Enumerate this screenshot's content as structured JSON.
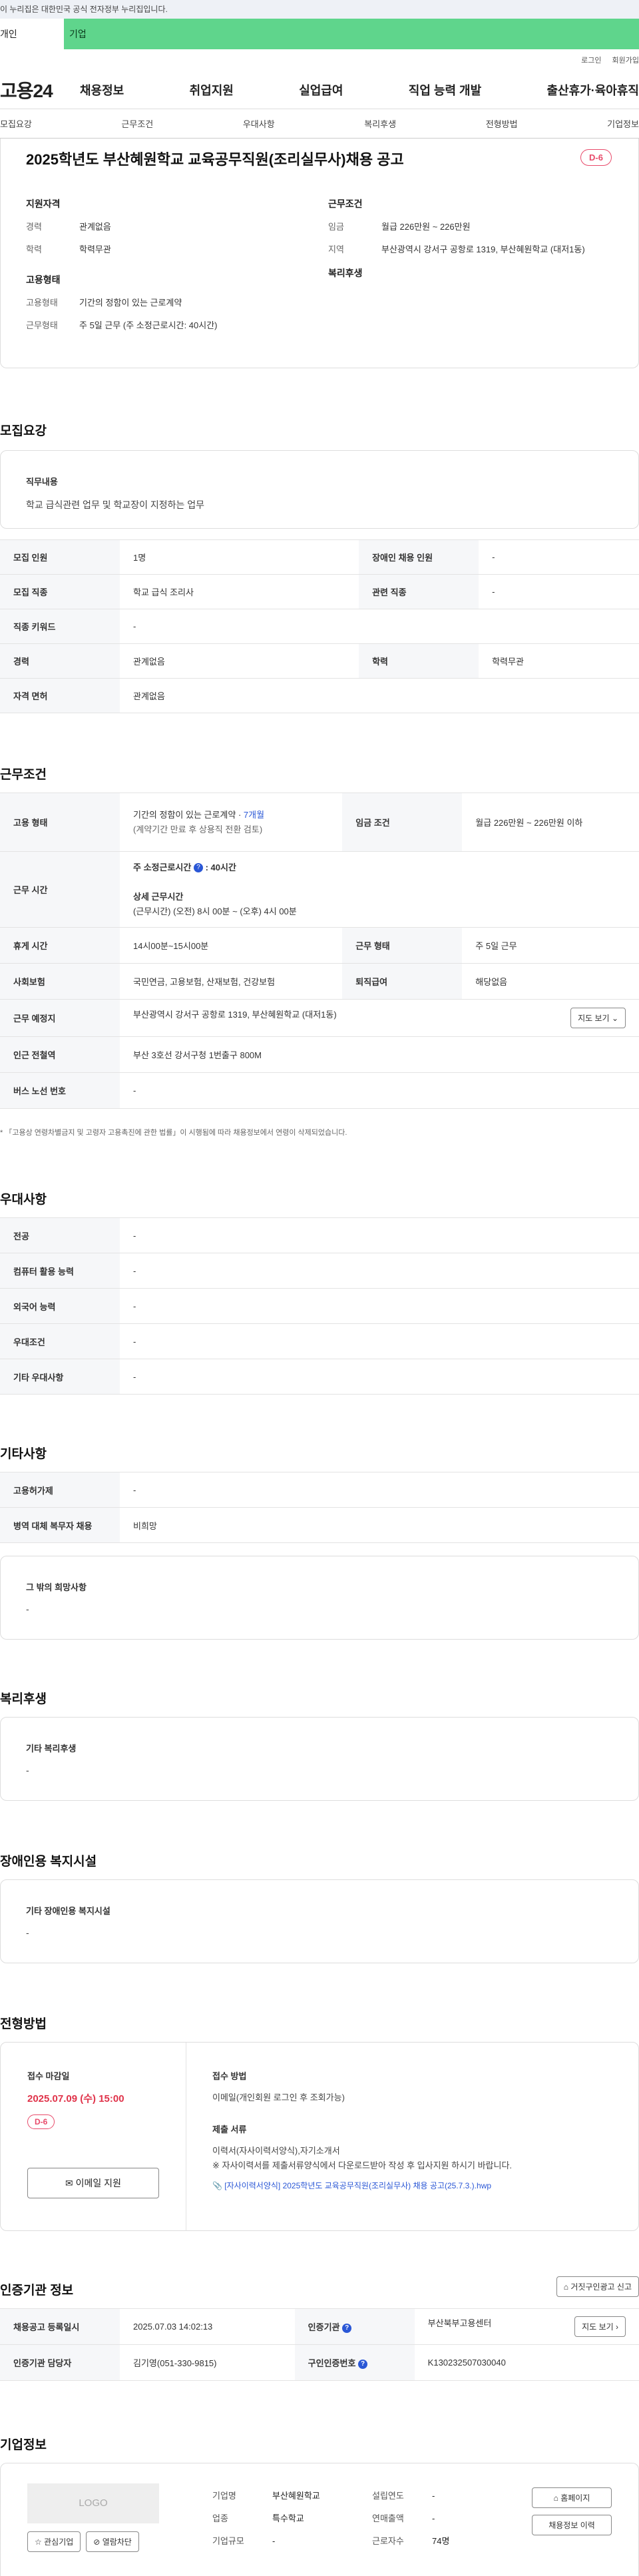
{
  "gov_banner": "이 누리집은 대한민국 공식 전자정부 누리집입니다.",
  "tabs": {
    "person": "개인",
    "company": "기업"
  },
  "util": {
    "login": "로그인",
    "join": "회원가입"
  },
  "logo": "고용24",
  "gnb": [
    "채용정보",
    "취업지원",
    "실업급여",
    "직업 능력 개발",
    "출산휴가·육아휴직"
  ],
  "subnav": [
    "모집요강",
    "근무조건",
    "우대사항",
    "복리후생",
    "전형방법",
    "기업정보"
  ],
  "job": {
    "title": "2025학년도 부산혜원학교 교육공무직원(조리실무사)채용 공고",
    "dday": "D-6",
    "summary": {
      "qualification_head": "지원자격",
      "career_key": "경력",
      "career_val": "관계없음",
      "edu_key": "학력",
      "edu_val": "학력무관",
      "employment_head": "고용형태",
      "emp_type_key": "고용형태",
      "emp_type_val": "기간의 정함이 있는 근로계약",
      "work_type_key": "근무형태",
      "work_type_val": "주 5일 근무 (주 소정근로시간: 40시간)",
      "condition_head": "근무조건",
      "wage_key": "임금",
      "wage_val": "월급 226만원 ~ 226만원",
      "location_key": "지역",
      "location_val": "부산광역시 강서구 공항로 1319, 부산혜원학교 (대저1동)",
      "welfare_head": "복리후생"
    }
  },
  "recruit": {
    "section": "모집요강",
    "duty_title": "직무내용",
    "duty_value": "학교 급식관련 업무 및 학교장이 지정하는 업무",
    "rows": [
      {
        "k1": "모집 인원",
        "v1": "1명",
        "k2": "장애인 채용 인원",
        "v2": "-"
      },
      {
        "k1": "모집 직종",
        "v1": "학교 급식 조리사",
        "k2": "관련 직종",
        "v2": "-"
      },
      {
        "k1": "직종 키워드",
        "v1": "-"
      },
      {
        "k1": "경력",
        "v1": "관계없음",
        "k2": "학력",
        "v2": "학력무관"
      },
      {
        "k1": "자격 면허",
        "v1": "관계없음"
      }
    ]
  },
  "work": {
    "section": "근무조건",
    "emp_key": "고용 형태",
    "emp_val": "기간의 정함이 있는 근로계약 ·",
    "emp_months": "7개월",
    "emp_sub": "(계약기간 만료 후 상용직 전환 검토)",
    "wage_key": "임금 조건",
    "wage_val": "월급 226만원 ~ 226만원 이하",
    "hours_key": "근무 시간",
    "hours_label": "주 소정근로시간",
    "hours_val": ": 40시간",
    "detail_label": "상세 근무시간",
    "detail_val": "(근무시간) (오전) 8시 00분 ~ (오후) 4시 00분",
    "break_key": "휴게 시간",
    "break_val": "14시00분~15시00분",
    "form_key": "근무 형태",
    "form_val": "주 5일 근무",
    "insure_key": "사회보험",
    "insure_val": "국민연금, 고용보험, 산재보험, 건강보험",
    "severance_key": "퇴직급여",
    "severance_val": "해당없음",
    "place_key": "근무 예정지",
    "place_val": "부산광역시 강서구 공항로 1319, 부산혜원학교 (대저1동)",
    "map_btn": "지도 보기",
    "subway_key": "인근 전철역",
    "subway_val": "부산 3호선 강서구청 1번출구 800M",
    "bus_key": "버스 노선 번호",
    "bus_val": "-",
    "note": "「고용상 연령차별금지 및 고령자 고용촉진에 관한 법률」이 시행됨에 따라 채용정보에서 연령이 삭제되었습니다."
  },
  "pref": {
    "section": "우대사항",
    "rows": [
      {
        "k": "전공",
        "v": "-"
      },
      {
        "k": "컴퓨터 활용 능력",
        "v": "-"
      },
      {
        "k": "외국어 능력",
        "v": "-"
      },
      {
        "k": "우대조건",
        "v": "-"
      },
      {
        "k": "기타 우대사항",
        "v": "-"
      }
    ]
  },
  "etc": {
    "section": "기타사항",
    "rows": [
      {
        "k": "고용허가제",
        "v": "-"
      },
      {
        "k": "병역 대체 복무자 채용",
        "v": "비희망"
      }
    ],
    "other_title": "그 밖의 희망사항",
    "other_val": "-"
  },
  "welfare": {
    "section": "복리후생",
    "title": "기타 복리후생",
    "val": "-"
  },
  "disabled": {
    "section": "장애인용 복지시설",
    "title": "기타 장애인용 복지시설",
    "val": "-"
  },
  "screening": {
    "section": "전형방법",
    "deadline_label": "접수 마감일",
    "deadline": "2025.07.09 (수) 15:00",
    "dday": "D-6",
    "email_btn": "이메일 지원",
    "method_label": "접수 방법",
    "method_val": "이메일(개인회원 로그인 후 조회가능)",
    "docs_label": "제출 서류",
    "docs_val": "이력서(자사이력서양식),자기소개서",
    "docs_note": "※ 자사이력서를 제출서류양식에서 다운로드받아 작성 후 입사지원 하시기 바랍니다.",
    "file": "[자사이력서양식] 2025학년도 교육공무직원(조리실무사) 채용 공고(25.7.3.).hwp"
  },
  "cert": {
    "section": "인증기관 정보",
    "report_btn": "거짓구인광고 신고",
    "reg_key": "채용공고 등록일시",
    "reg_val": "2025.07.03 14:02:13",
    "agency_key": "인증기관",
    "agency_val": "부산북부고용센터",
    "map_btn": "지도 보기",
    "manager_key": "인증기관 담당자",
    "manager_val": "김기영(051-330-9815)",
    "reqno_key": "구인인증번호",
    "reqno_val": "K130232507030040"
  },
  "company": {
    "section": "기업정보",
    "logo": "LOGO",
    "fav_btn": "관심기업",
    "block_btn": "열람차단",
    "name_key": "기업명",
    "name_val": "부산혜원학교",
    "type_key": "업종",
    "type_val": "특수학교",
    "scale_key": "기업규모",
    "scale_val": "-",
    "year_key": "설립연도",
    "year_val": "-",
    "sales_key": "연매출액",
    "sales_val": "-",
    "emp_key": "근로자수",
    "emp_val": "74명",
    "home_btn": "홈페이지",
    "history_btn": "채용정보 이력"
  }
}
